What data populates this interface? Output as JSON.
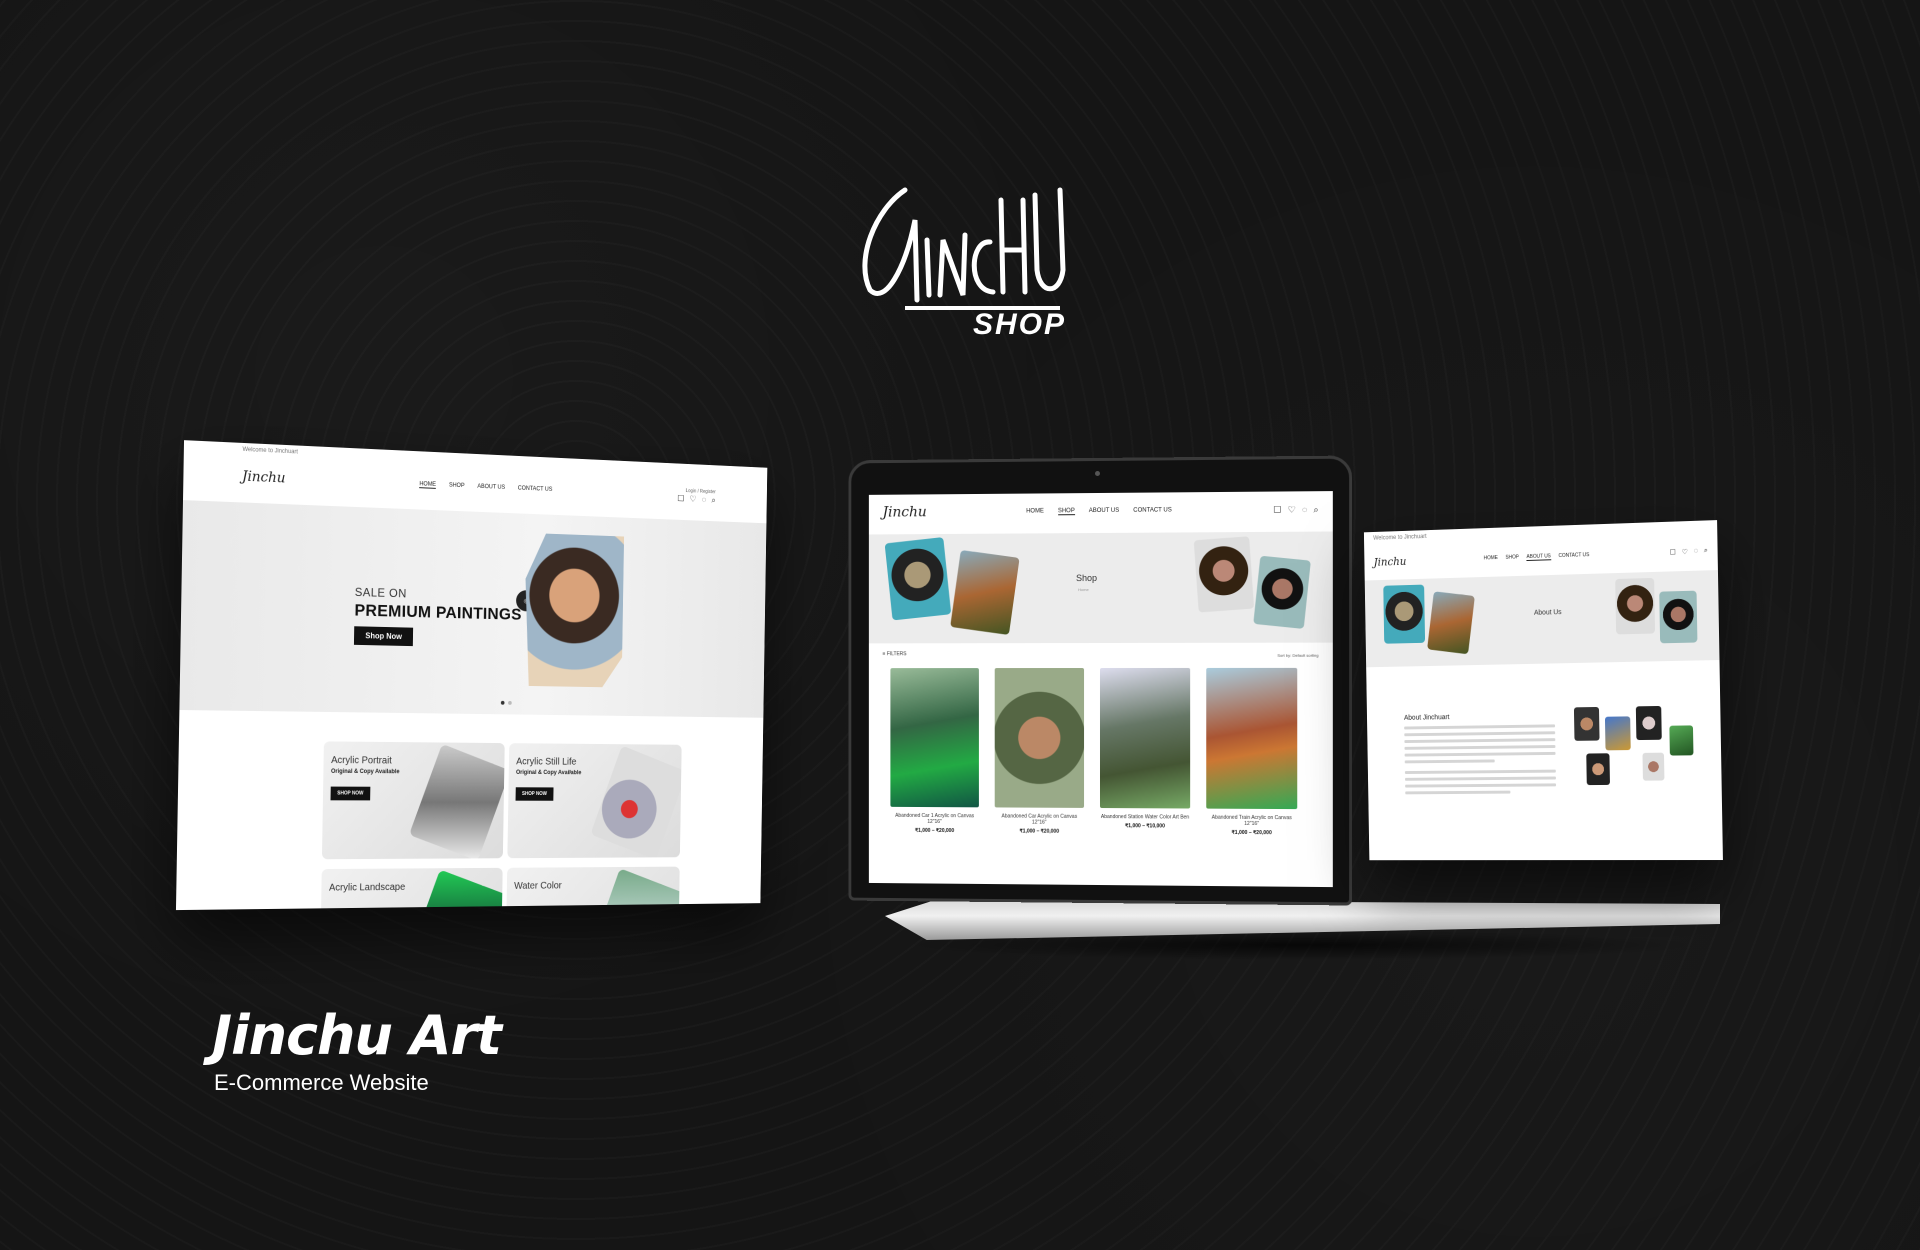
{
  "brand": {
    "logo_text": "JINCHU",
    "logo_sub": "SHOP"
  },
  "project": {
    "title": "Jinchu Art",
    "subtitle": "E-Commerce Website"
  },
  "site": {
    "welcome": "Welcome to Jinchuart",
    "logo": "Jinchu",
    "nav": [
      "HOME",
      "SHOP",
      "ABOUT US",
      "CONTACT US"
    ],
    "auth": "Login / Register",
    "icons": [
      "account-icon",
      "heart-icon",
      "cart-icon",
      "search-icon"
    ]
  },
  "home": {
    "hero_sale": "SALE ON",
    "hero_title": "PREMIUM PAINTINGS",
    "hero_button": "Shop Now",
    "categories": [
      {
        "name": "Acrylic Portrait",
        "sub": "Original & Copy Available",
        "button": "SHOP NOW"
      },
      {
        "name": "Acrylic Still Life",
        "sub": "Original & Copy Available",
        "button": "SHOP NOW"
      },
      {
        "name": "Acrylic Landscape",
        "sub": "",
        "button": ""
      },
      {
        "name": "Water Color",
        "sub": "",
        "button": ""
      }
    ]
  },
  "shop": {
    "title": "Shop",
    "breadcrumb": "Home",
    "filters": "FILTERS",
    "sort": "Sort by: Default sorting",
    "products": [
      {
        "name": "Abandoned Car 1 Acrylic on Canvas 12\"16\"",
        "price": "₹1,000 – ₹20,000"
      },
      {
        "name": "Abandoned Car Acrylic on Canvas 12\"16\"",
        "price": "₹1,000 – ₹20,000"
      },
      {
        "name": "Abandoned Station Water Color Art Ben",
        "price": "₹1,000 – ₹10,000"
      },
      {
        "name": "Abandoned Train Acrylic on Canvas 12\"16\"",
        "price": "₹1,000 – ₹20,000"
      }
    ]
  },
  "about": {
    "banner_title": "About Us",
    "heading": "About Jinchuart"
  },
  "colors": {
    "background": "#151515",
    "accent": "#111111"
  }
}
